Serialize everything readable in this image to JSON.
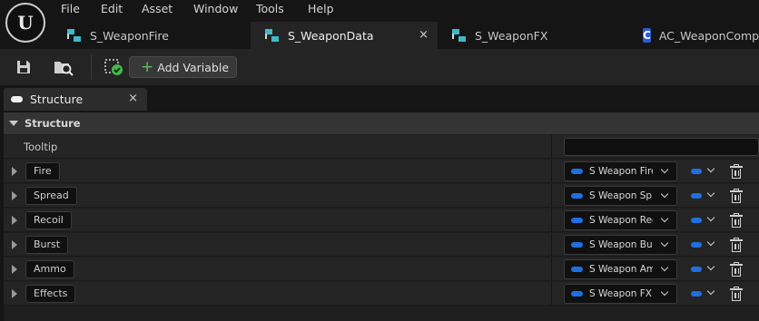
{
  "menu": [
    "File",
    "Edit",
    "Asset",
    "Window",
    "Tools",
    "Help"
  ],
  "doc_tabs": [
    {
      "label": "S_WeaponFire",
      "icon": "struct-icon",
      "active": false
    },
    {
      "label": "S_WeaponData",
      "icon": "struct-icon",
      "active": true,
      "close": "×"
    },
    {
      "label": "S_WeaponFX",
      "icon": "struct-icon",
      "active": false
    },
    {
      "label": "AC_WeaponComp",
      "icon": "blueprint-icon",
      "icon_text": "C",
      "active": false
    }
  ],
  "toolbar": {
    "save_icon": "save-icon",
    "browse_icon": "browse-to-asset-icon",
    "defaults_icon": "default-values-check-icon",
    "add_variable_label": "Add Variable",
    "plus_glyph": "+"
  },
  "panel_tab": {
    "label": "Structure",
    "close": "×"
  },
  "structure": {
    "category_label": "Structure",
    "tooltip_label": "Tooltip",
    "tooltip_value": "",
    "members": [
      {
        "name": "Fire",
        "type": "S Weapon Fire"
      },
      {
        "name": "Spread",
        "type": "S Weapon Spread"
      },
      {
        "name": "Recoil",
        "type": "S Weapon Recoil"
      },
      {
        "name": "Burst",
        "type": "S Weapon Burst"
      },
      {
        "name": "Ammo",
        "type": "S Weapon Ammo"
      },
      {
        "name": "Effects",
        "type": "S Weapon FX"
      }
    ]
  },
  "colors": {
    "pin_struct": "#1f6fe0",
    "add_plus": "#5cc05c",
    "accent_teal": "#3fb8c8"
  }
}
